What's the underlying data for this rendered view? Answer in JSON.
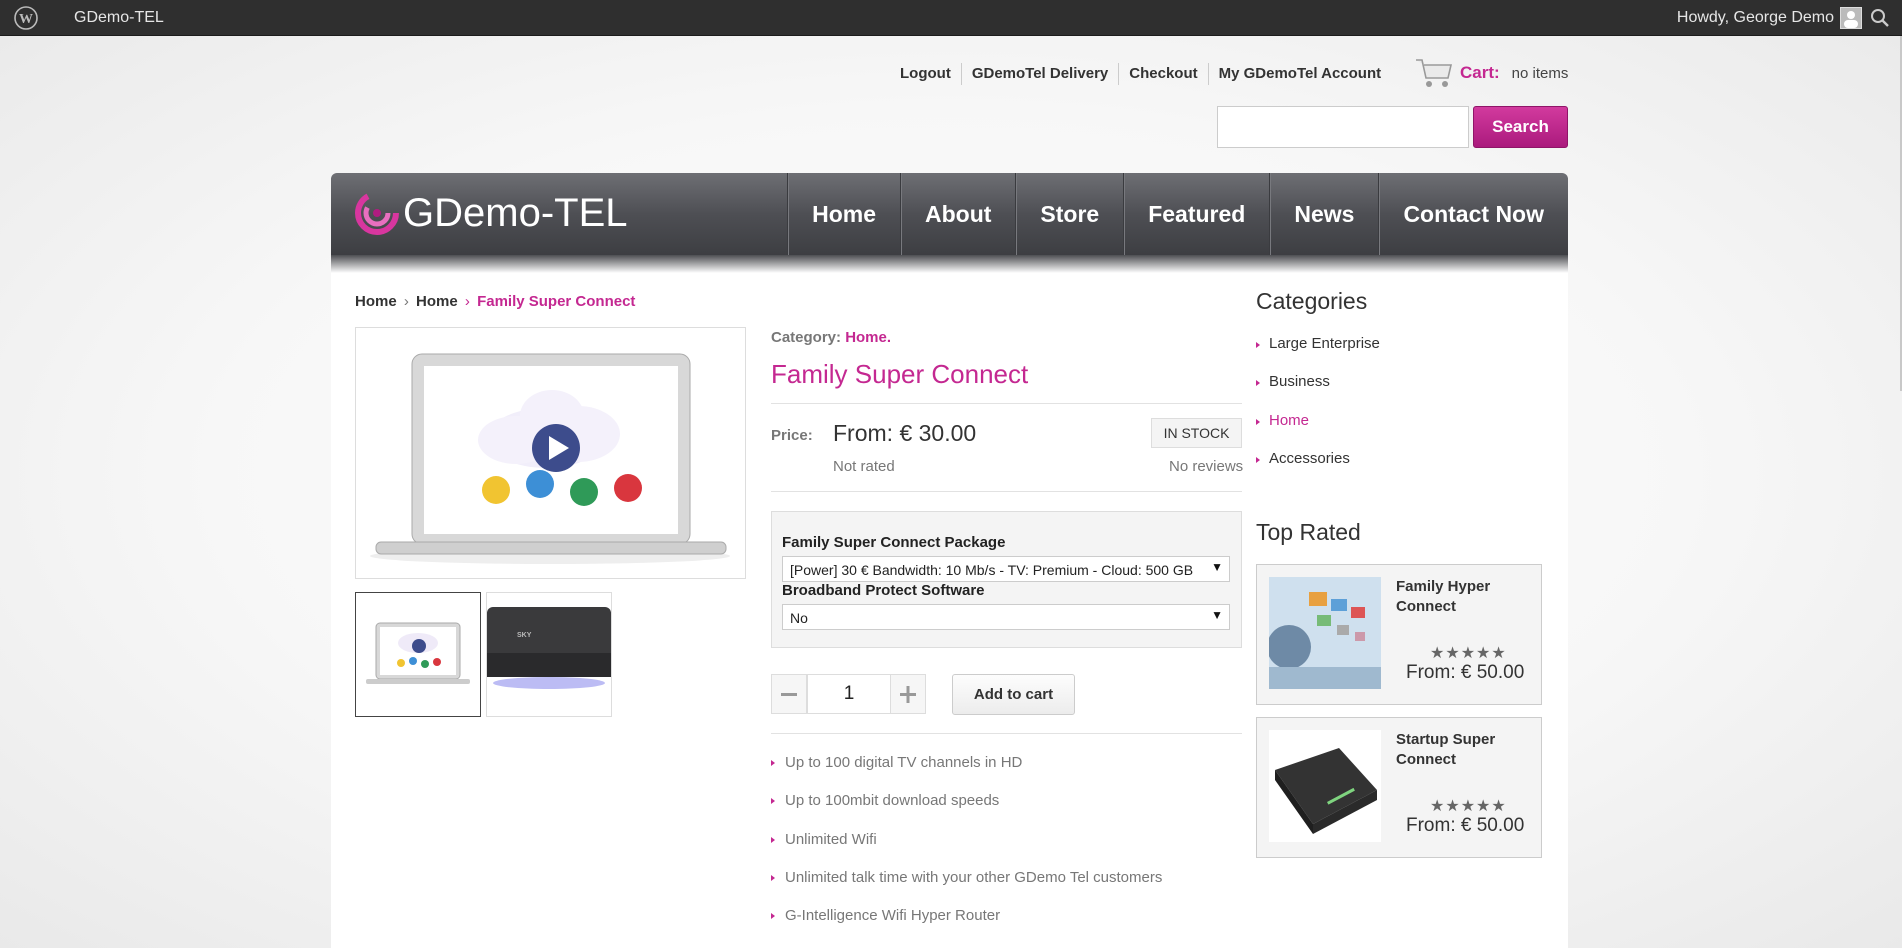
{
  "admin_bar": {
    "site_name": "GDemo-TEL",
    "howdy": "Howdy, George Demo"
  },
  "top_links": [
    "Logout",
    "GDemoTel Delivery",
    "Checkout",
    "My GDemoTel Account"
  ],
  "cart": {
    "label": "Cart:",
    "count": "no items"
  },
  "search": {
    "button": "Search",
    "value": ""
  },
  "logo": {
    "text": "GDemo-TEL"
  },
  "nav": [
    "Home",
    "About",
    "Store",
    "Featured",
    "News",
    "Contact Now"
  ],
  "breadcrumb": {
    "item1": "Home",
    "item2": "Home",
    "current": "Family Super Connect",
    "separator": "›"
  },
  "product": {
    "category_label": "Category:",
    "category_value": "Home.",
    "title": "Family Super Connect",
    "price_label": "Price:",
    "price": "From: € 30.00",
    "stock": "IN STOCK",
    "rating": "Not rated",
    "reviews": "No reviews",
    "options": [
      {
        "label": "Family Super Connect Package",
        "selected": "[Power] 30 € Bandwidth: 10 Mb/s - TV: Premium - Cloud: 500 GB"
      },
      {
        "label": "Broadband Protect Software",
        "selected": "No"
      }
    ],
    "quantity": "1",
    "add_to_cart": "Add to cart",
    "features": [
      "Up to 100 digital TV channels in HD",
      "Up to 100mbit download speeds",
      "Unlimited Wifi",
      "Unlimited talk time with your other GDemo Tel customers",
      "G-Intelligence Wifi Hyper Router"
    ]
  },
  "sidebar": {
    "categories_title": "Categories",
    "categories": [
      "Large Enterprise",
      "Business",
      "Home",
      "Accessories"
    ],
    "active_category": "Home",
    "top_rated_title": "Top Rated",
    "top_rated": [
      {
        "name": "Family Hyper Connect",
        "stars": "★★★★★",
        "rating": 4.5,
        "price": "From: € 50.00"
      },
      {
        "name": "Startup Super Connect",
        "stars": "★★★★★",
        "rating": 5,
        "price": "From: € 50.00"
      }
    ]
  },
  "colors": {
    "accent": "#c42891",
    "admin_bar": "#2f2f2f",
    "nav_bg": "#4e4f54"
  }
}
